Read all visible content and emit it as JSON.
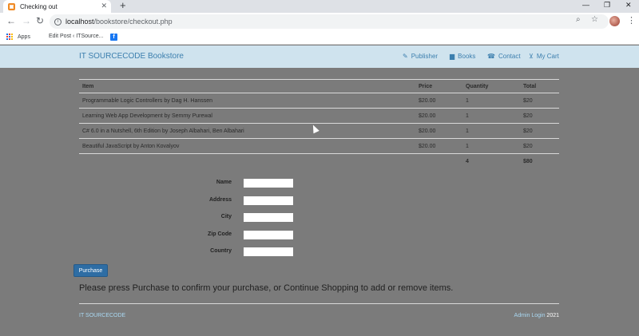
{
  "browser": {
    "tab_title": "Checking out",
    "url_host": "localhost",
    "url_path": "/bookstore/checkout.php",
    "bookmarks": [
      "Apps",
      "Edit Post ‹ ITSource..."
    ]
  },
  "navbar": {
    "brand": "IT SOURCECODE Bookstore",
    "links": [
      {
        "label": "Publisher",
        "icon": "pencil-icon"
      },
      {
        "label": "Books",
        "icon": "book-icon"
      },
      {
        "label": "Contact",
        "icon": "phone-icon"
      },
      {
        "label": "My Cart",
        "icon": "cart-icon"
      }
    ]
  },
  "cart": {
    "headers": [
      "Item",
      "Price",
      "Quantity",
      "Total"
    ],
    "rows": [
      {
        "item": "Programmable Logic Controllers by Dag H. Hanssen",
        "price": "$20.00",
        "quantity": "1",
        "total": "$20"
      },
      {
        "item": "Learning Web App Development by Semmy Purewal",
        "price": "$20.00",
        "quantity": "1",
        "total": "$20"
      },
      {
        "item": "C# 6.0 in a Nutshell, 6th Edition by Joseph Albahari, Ben Albahari",
        "price": "$20.00",
        "quantity": "1",
        "total": "$20"
      },
      {
        "item": "Beautiful JavaScript by Anton Kovalyov",
        "price": "$20.00",
        "quantity": "1",
        "total": "$20"
      }
    ],
    "total_quantity": "4",
    "total_amount": "$80"
  },
  "form": {
    "fields": [
      {
        "label": "Name",
        "value": ""
      },
      {
        "label": "Address",
        "value": ""
      },
      {
        "label": "City",
        "value": ""
      },
      {
        "label": "Zip Code",
        "value": ""
      },
      {
        "label": "Country",
        "value": ""
      }
    ]
  },
  "purchase_label": "Purchase",
  "confirm_message": "Please press Purchase to confirm your purchase, or Continue Shopping to add or remove items.",
  "footer": {
    "brand": "IT SOURCECODE",
    "admin_login": "Admin Login",
    "year": "2021"
  },
  "colors": {
    "page_background": "#7b7b7b",
    "navbar_background": "#cfe3ee",
    "link_blue": "#3c7fae",
    "button_blue": "#2e6da4"
  }
}
